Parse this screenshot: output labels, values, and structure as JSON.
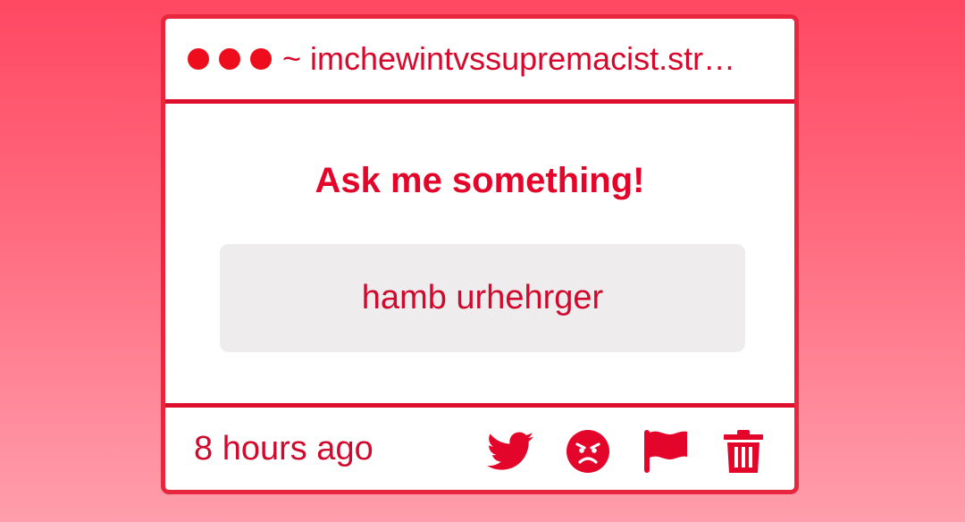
{
  "window": {
    "title": "~ imchewintvssupremacist.str…",
    "dots": [
      "red",
      "red",
      "red"
    ]
  },
  "card": {
    "heading": "Ask me something!",
    "answer": "hamb urhehrger"
  },
  "footer": {
    "timestamp": "8 hours ago",
    "actions": [
      {
        "name": "twitter",
        "icon": "twitter-bird-icon"
      },
      {
        "name": "angry",
        "icon": "angry-face-icon"
      },
      {
        "name": "flag",
        "icon": "flag-icon"
      },
      {
        "name": "delete",
        "icon": "trash-icon"
      }
    ]
  },
  "colors": {
    "accent": "#e4062a",
    "border": "#dd0f2c",
    "answer_bg": "#eeeced",
    "background_top": "#ff4862",
    "background_bottom": "#ff9eac"
  }
}
